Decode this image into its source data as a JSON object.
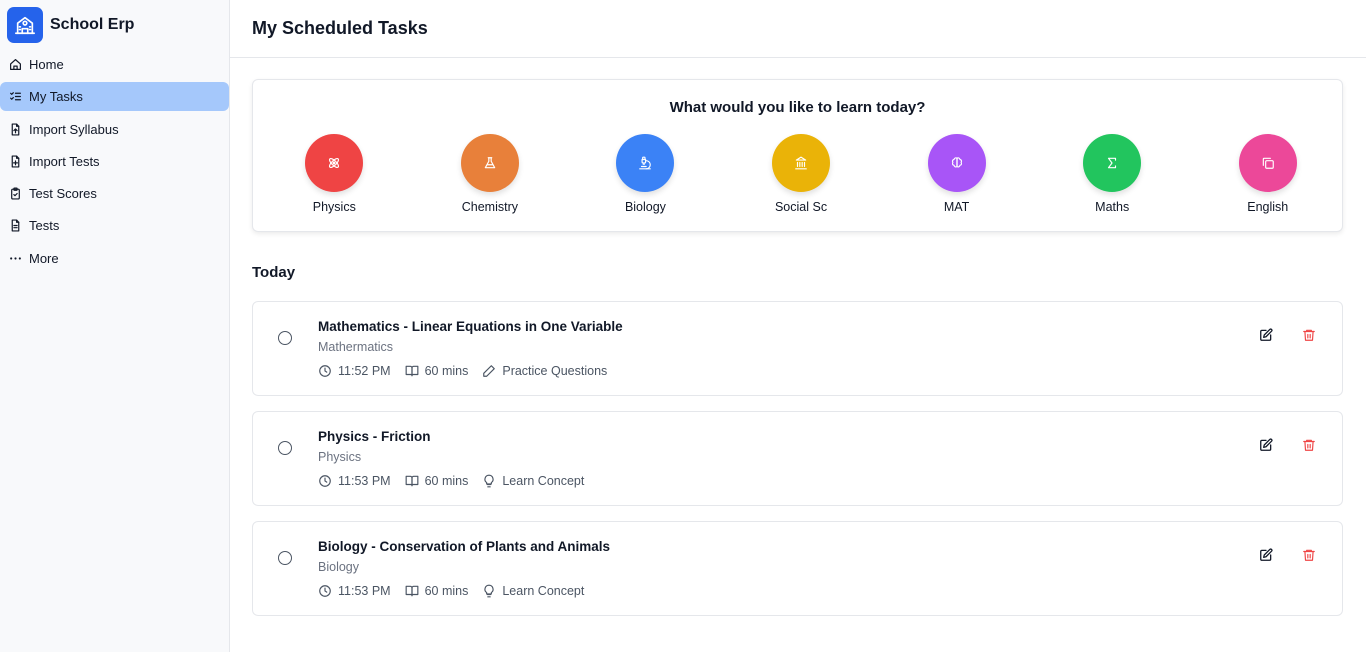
{
  "app": {
    "name": "School Erp"
  },
  "sidebar": {
    "items": [
      {
        "label": "Home",
        "icon": "home-icon",
        "active": false
      },
      {
        "label": "My Tasks",
        "icon": "list-checks-icon",
        "active": true
      },
      {
        "label": "Import Syllabus",
        "icon": "file-upload-icon",
        "active": false
      },
      {
        "label": "Import Tests",
        "icon": "file-plus-icon",
        "active": false
      },
      {
        "label": "Test Scores",
        "icon": "clipboard-check-icon",
        "active": false
      },
      {
        "label": "Tests",
        "icon": "file-text-icon",
        "active": false
      },
      {
        "label": "More",
        "icon": "more-dots-icon",
        "active": false
      }
    ]
  },
  "header": {
    "title": "My Scheduled Tasks"
  },
  "subjects": {
    "prompt": "What would you like to learn today?",
    "items": [
      {
        "label": "Physics",
        "color": "#ef4444",
        "icon": "atom-icon"
      },
      {
        "label": "Chemistry",
        "color": "#e8803a",
        "icon": "flask-icon"
      },
      {
        "label": "Biology",
        "color": "#3b82f6",
        "icon": "microscope-icon"
      },
      {
        "label": "Social Sc",
        "color": "#eab308",
        "icon": "landmark-icon"
      },
      {
        "label": "MAT",
        "color": "#a855f7",
        "icon": "brain-icon"
      },
      {
        "label": "Maths",
        "color": "#22c55e",
        "icon": "sigma-icon"
      },
      {
        "label": "English",
        "color": "#ec4899",
        "icon": "copy-icon"
      }
    ]
  },
  "today": {
    "title": "Today",
    "tasks": [
      {
        "title": "Mathematics - Linear Equations in One Variable",
        "subject": "Mathermatics",
        "time": "11:52 PM",
        "duration": "60 mins",
        "type": "Practice Questions",
        "type_icon": "pencil-icon"
      },
      {
        "title": "Physics - Friction",
        "subject": "Physics",
        "time": "11:53 PM",
        "duration": "60 mins",
        "type": "Learn Concept",
        "type_icon": "lightbulb-icon"
      },
      {
        "title": "Biology - Conservation of Plants and Animals",
        "subject": "Biology",
        "time": "11:53 PM",
        "duration": "60 mins",
        "type": "Learn Concept",
        "type_icon": "lightbulb-icon"
      }
    ]
  },
  "colors": {
    "accent": "#2563eb",
    "active_nav": "#a5c8fb",
    "delete": "#ef4444"
  }
}
